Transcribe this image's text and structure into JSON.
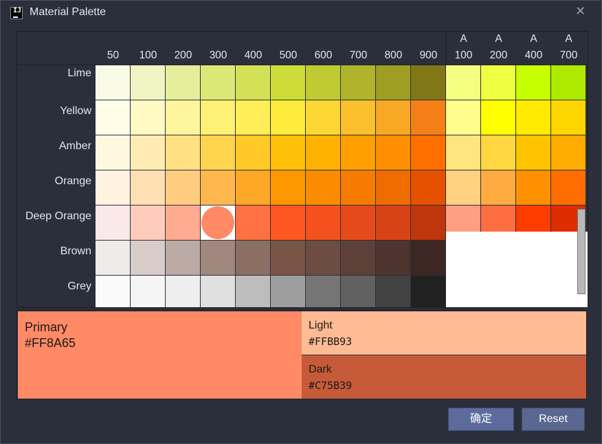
{
  "window": {
    "title": "Material Palette",
    "close_glyph": "✕"
  },
  "columns": [
    {
      "top": "",
      "bottom": "50"
    },
    {
      "top": "",
      "bottom": "100"
    },
    {
      "top": "",
      "bottom": "200"
    },
    {
      "top": "",
      "bottom": "300"
    },
    {
      "top": "",
      "bottom": "400"
    },
    {
      "top": "",
      "bottom": "500"
    },
    {
      "top": "",
      "bottom": "600"
    },
    {
      "top": "",
      "bottom": "700"
    },
    {
      "top": "",
      "bottom": "800"
    },
    {
      "top": "",
      "bottom": "900"
    },
    {
      "top": "A",
      "bottom": "100"
    },
    {
      "top": "A",
      "bottom": "200"
    },
    {
      "top": "A",
      "bottom": "400"
    },
    {
      "top": "A",
      "bottom": "700"
    }
  ],
  "rows": [
    {
      "name": "Lime",
      "colors": [
        "#F9FBE7",
        "#F0F4C3",
        "#E6EE9C",
        "#DCE775",
        "#D4E157",
        "#CDDC39",
        "#C0CA33",
        "#AFB42B",
        "#9E9D24",
        "#827717",
        "#F4FF81",
        "#EEFF41",
        "#C6FF00",
        "#AEEA00"
      ]
    },
    {
      "name": "Yellow",
      "colors": [
        "#FFFDE7",
        "#FFF9C4",
        "#FFF59D",
        "#FFF176",
        "#FFEE58",
        "#FFEB3B",
        "#FDD835",
        "#FBC02D",
        "#F9A825",
        "#F57F17",
        "#FFFF8D",
        "#FFFF00",
        "#FFEA00",
        "#FFD600"
      ]
    },
    {
      "name": "Amber",
      "colors": [
        "#FFF8E1",
        "#FFECB3",
        "#FFE082",
        "#FFD54F",
        "#FFCA28",
        "#FFC107",
        "#FFB300",
        "#FFA000",
        "#FF8F00",
        "#FF6F00",
        "#FFE57F",
        "#FFD740",
        "#FFC400",
        "#FFAB00"
      ]
    },
    {
      "name": "Orange",
      "colors": [
        "#FFF3E0",
        "#FFE0B2",
        "#FFCC80",
        "#FFB74D",
        "#FFA726",
        "#FF9800",
        "#FB8C00",
        "#F57C00",
        "#EF6C00",
        "#E65100",
        "#FFD180",
        "#FFAB40",
        "#FF9100",
        "#FF6D00"
      ]
    },
    {
      "name": "Deep Orange",
      "colors": [
        "#FBE9E7",
        "#FFCCBC",
        "#FFAB91",
        "#FF8A65",
        "#FF7043",
        "#FF5722",
        "#F4511E",
        "#E64A19",
        "#D84315",
        "#BF360C",
        "#FF9E80",
        "#FF6E40",
        "#FF3D00",
        "#DD2C00"
      ]
    },
    {
      "name": "Brown",
      "colors": [
        "#EFEBE9",
        "#D7CCC8",
        "#BCAAA4",
        "#A1887F",
        "#8D6E63",
        "#795548",
        "#6D4C41",
        "#5D4037",
        "#4E342E",
        "#3E2723"
      ]
    },
    {
      "name": "Grey",
      "colors": [
        "#FAFAFA",
        "#F5F5F5",
        "#EEEEEE",
        "#E0E0E0",
        "#BDBDBD",
        "#9E9E9E",
        "#757575",
        "#616161",
        "#424242",
        "#212121"
      ]
    },
    {
      "name": "",
      "colors": [
        "#ECEFF1",
        "#CFD8DC",
        "#B0BEC5",
        "#90A4AE",
        "#78909C",
        "#607D8B",
        "#546E7A",
        "#455A64",
        "#37474F",
        "#263238"
      ]
    }
  ],
  "selected": {
    "row": 4,
    "col": 3
  },
  "preview": {
    "primary_label": "Primary",
    "primary_hex": "#FF8A65",
    "light_label": "Light",
    "light_hex": "#FFBB93",
    "dark_label": "Dark",
    "dark_hex": "#C75B39"
  },
  "buttons": {
    "ok": "确定",
    "reset": "Reset"
  }
}
